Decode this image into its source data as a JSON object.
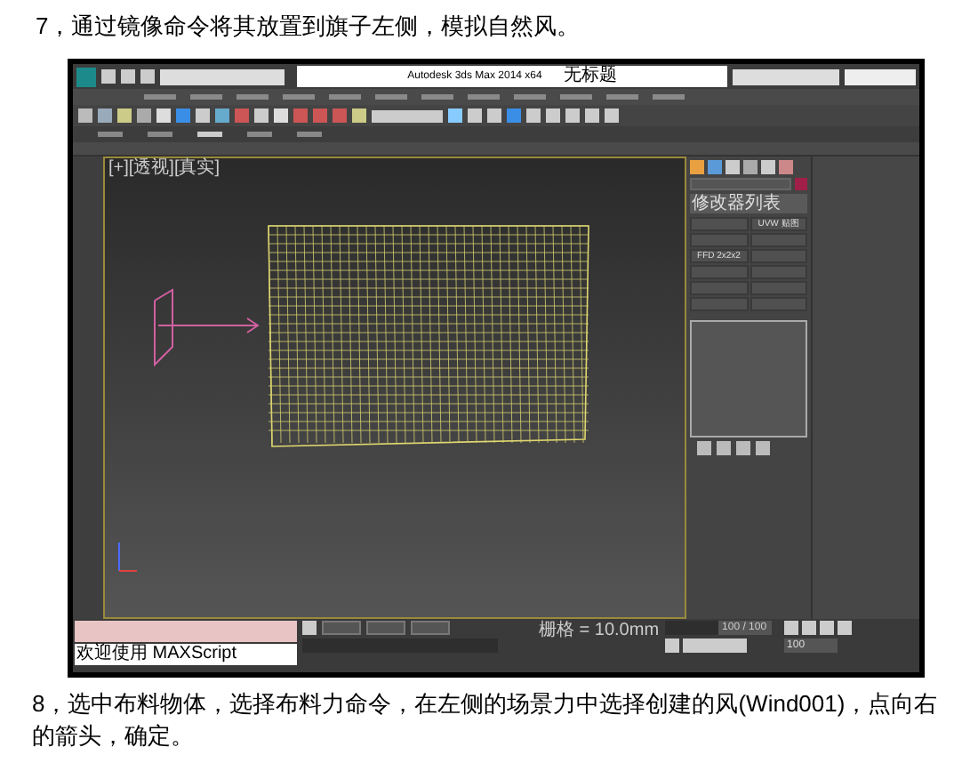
{
  "heading": "7，通过镜像命令将其放置到旗子左侧，模拟自然风。",
  "app": {
    "title": "Autodesk 3ds Max  2014 x64",
    "document": "无标题",
    "viewport_label": "[+][透视][真实]",
    "command_panel": {
      "dropdown": "修改器列表",
      "buttons": [
        {
          "kind": "blank"
        },
        {
          "kind": "labeled",
          "label": "UVW 贴图"
        },
        {
          "kind": "blank"
        },
        {
          "kind": "blank"
        },
        {
          "kind": "labeled",
          "label": "FFD 2x2x2"
        },
        {
          "kind": "blank"
        },
        {
          "kind": "blank"
        },
        {
          "kind": "blank"
        },
        {
          "kind": "blank"
        },
        {
          "kind": "blank"
        },
        {
          "kind": "blank"
        },
        {
          "kind": "blank"
        }
      ]
    },
    "listener": "欢迎使用 MAXScript",
    "grid": "栅格 = 10.0mm",
    "time_slider": {
      "reading": "100 / 100",
      "level": 1
    },
    "frame": "100"
  },
  "paragraph": "8，选中布料物体，选择布料力命令，在左侧的场景力中选择创建的风(Wind001)，点向右的箭头，确定。"
}
